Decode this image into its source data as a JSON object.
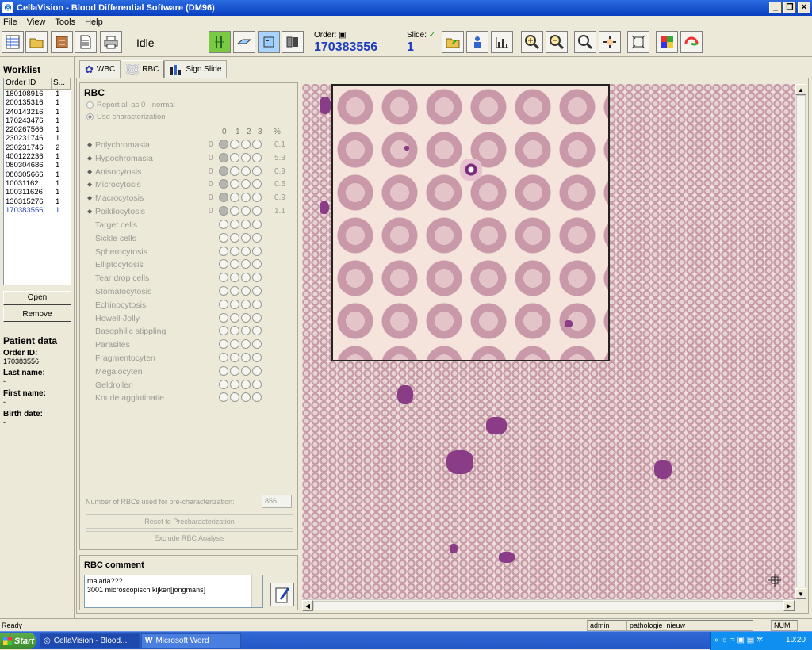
{
  "window": {
    "title": "CellaVision - Blood Differential Software (DM96)"
  },
  "menu": [
    "File",
    "View",
    "Tools",
    "Help"
  ],
  "toolbar": {
    "status": "Idle",
    "order_label": "Order:",
    "order_value": "170383556",
    "slide_label": "Slide:",
    "slide_value": "1"
  },
  "worklist": {
    "title": "Worklist",
    "col_order": "Order ID",
    "col_s": "S...",
    "rows": [
      {
        "id": "180108916",
        "s": "1"
      },
      {
        "id": "200135316",
        "s": "1"
      },
      {
        "id": "240143216",
        "s": "1"
      },
      {
        "id": "170243476",
        "s": "1"
      },
      {
        "id": "220267566",
        "s": "1"
      },
      {
        "id": "230231746",
        "s": "1"
      },
      {
        "id": "230231746",
        "s": "2"
      },
      {
        "id": "400122236",
        "s": "1"
      },
      {
        "id": "080304686",
        "s": "1"
      },
      {
        "id": "080305666",
        "s": "1"
      },
      {
        "id": "10031162",
        "s": "1"
      },
      {
        "id": "100311626",
        "s": "1"
      },
      {
        "id": "130315276",
        "s": "1"
      },
      {
        "id": "170383556",
        "s": "1"
      }
    ],
    "open_label": "Open",
    "remove_label": "Remove"
  },
  "patient": {
    "title": "Patient data",
    "order_label": "Order ID:",
    "order_value": "170383556",
    "last_label": "Last name:",
    "last_value": "-",
    "first_label": "First name:",
    "first_value": "-",
    "birth_label": "Birth date:",
    "birth_value": "-"
  },
  "tabs": [
    {
      "label": "WBC"
    },
    {
      "label": "RBC"
    },
    {
      "label": "Sign Slide"
    }
  ],
  "rbc": {
    "title": "RBC",
    "opt1": "Report all as 0 - normal",
    "opt2": "Use characterization",
    "col0": "0",
    "col1": "1",
    "col2": "2",
    "col3": "3",
    "colpct": "%",
    "prechar_rows": [
      {
        "name": "Polychromasia",
        "zero": "0",
        "pct": "0.1"
      },
      {
        "name": "Hypochromasia",
        "zero": "0",
        "pct": "5.3"
      },
      {
        "name": "Anisocytosis",
        "zero": "0",
        "pct": "0.9"
      },
      {
        "name": "Microcytosis",
        "zero": "0",
        "pct": "0.5"
      },
      {
        "name": "Macrocytosis",
        "zero": "0",
        "pct": "0.9"
      },
      {
        "name": "Poikilocytosis",
        "zero": "0",
        "pct": "1.1"
      }
    ],
    "other_rows": [
      {
        "name": "Target cells"
      },
      {
        "name": "Sickle cells"
      },
      {
        "name": "Spherocytosis"
      },
      {
        "name": "Elliptocytosis"
      },
      {
        "name": "Tear drop cells"
      },
      {
        "name": "Stomatocytosis"
      },
      {
        "name": "Echinocytosis"
      },
      {
        "name": "Howell-Jolly"
      },
      {
        "name": "Basophilic stippling"
      },
      {
        "name": "Parasites"
      },
      {
        "name": "Fragmentocyten"
      },
      {
        "name": "Megalocyten"
      },
      {
        "name": "Geldrollen"
      },
      {
        "name": "Koude agglutinatie"
      }
    ],
    "prechar_label": "Number of RBCs used for pre-characterization:",
    "prechar_value": "856",
    "reset_label": "Reset to Precharacterization",
    "exclude_label": "Exclude RBC Analysis"
  },
  "comment": {
    "title": "RBC comment",
    "line1": "malaria???",
    "line2": "3001 microscopisch kijken[jongmans]"
  },
  "statusbar": {
    "status": "Ready",
    "user": "admin",
    "dept": "pathologie_nieuw",
    "num": "NUM"
  },
  "taskbar": {
    "start": "Start",
    "task1": "CellaVision - Blood...",
    "task2": "Microsoft Word",
    "time": "10:20"
  }
}
